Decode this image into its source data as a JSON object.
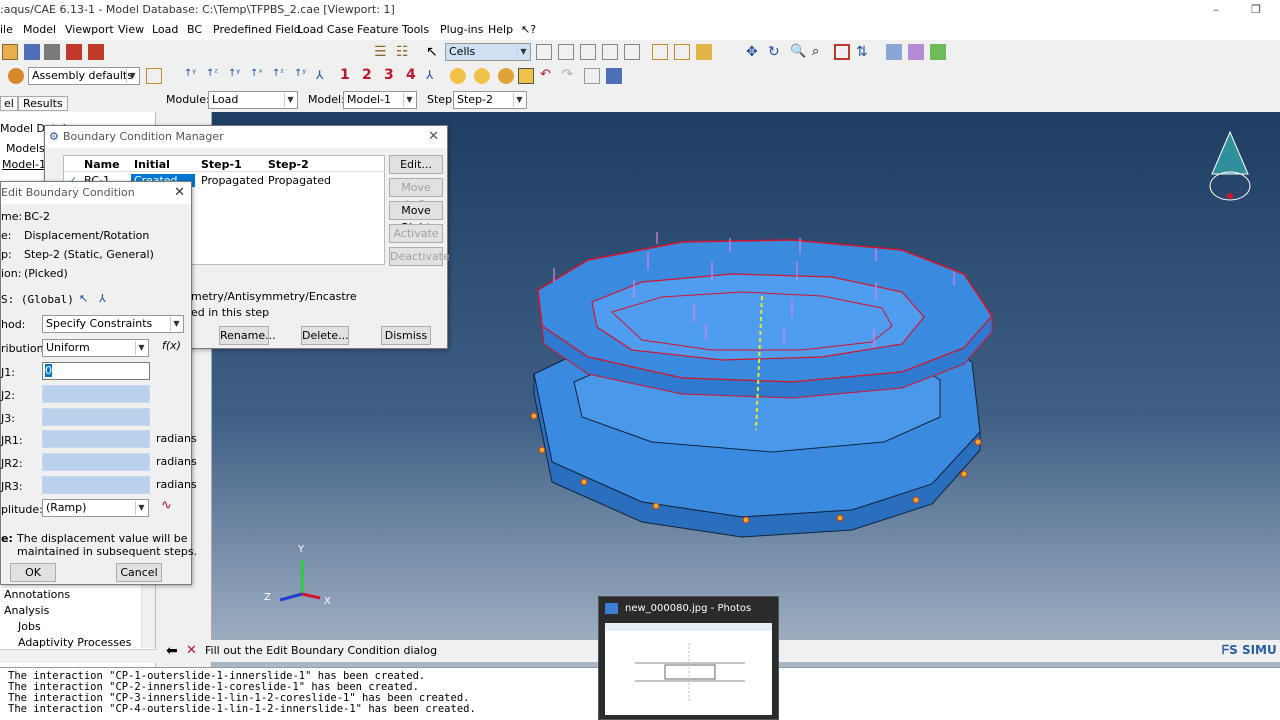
{
  "window": {
    "title": ":aqus/CAE 6.13-1 - Model Database: C:\\Temp\\TFPBS_2.cae [Viewport: 1]"
  },
  "menu": [
    "ile",
    "Model",
    "Viewport",
    "View",
    "Load",
    "BC",
    "Predefined Field",
    "Load Case",
    "Feature",
    "Tools",
    "Plug-ins",
    "Help",
    "⁄?"
  ],
  "toolbar": {
    "selection_filter": "Cells",
    "render_style": "Assembly defaults",
    "csys_numbers": [
      "1",
      "2",
      "3",
      "4"
    ]
  },
  "context": {
    "module_label": "Module:",
    "module_value": "Load",
    "model_label": "Model:",
    "model_value": "Model-1",
    "step_label": "Step:",
    "step_value": "Step-2"
  },
  "tree": {
    "tabs": [
      "el",
      "Results"
    ],
    "header": "Model Datab",
    "models": "Models",
    "model1": "Model-1",
    "items": [
      "Annotations",
      "Analysis",
      "Jobs",
      "Adaptivity Processes"
    ]
  },
  "bc_manager": {
    "title": "Boundary Condition Manager",
    "columns": [
      "Name",
      "Initial",
      "Step-1",
      "Step-2"
    ],
    "rows": [
      {
        "name": "BC-1",
        "initial": "Created",
        "step1": "Propagated",
        "step2": "Propagated"
      }
    ],
    "buttons": {
      "edit": "Edit...",
      "move_left": "Move Left",
      "move_right": "Move Right",
      "activate": "Activate",
      "deactivate": "Deactivate",
      "rename": "Rename...",
      "delete": "Delete...",
      "dismiss": "Dismiss"
    },
    "info_type": "metry/Antisymmetry/Encastre",
    "info_status": "ed in this step"
  },
  "edit_bc": {
    "title": "Edit Boundary Condition",
    "name_label": "me:",
    "name_value": "BC-2",
    "type_label": "e:",
    "type_value": "Displacement/Rotation",
    "step_label": "p:",
    "step_value": "Step-2 (Static, General)",
    "region_label": "ion:",
    "region_value": "(Picked)",
    "csys_label": "S: (Global)",
    "method_label": "hod:",
    "method_value": "Specify Constraints",
    "distribution_label": "ribution:",
    "distribution_value": "Uniform",
    "fx": "f(x)",
    "u1_label": "J1:",
    "u1_value": "0",
    "u2_label": "J2:",
    "u3_label": "J3:",
    "ur1_label": "JR1:",
    "ur2_label": "JR2:",
    "ur3_label": "JR3:",
    "radians": "radians",
    "amplitude_label": "plitude:",
    "amplitude_value": "(Ramp)",
    "note_label": "e:",
    "note_text": "The displacement value will be",
    "note_text2": "maintained in subsequent steps.",
    "ok": "OK",
    "cancel": "Cancel"
  },
  "status": {
    "prompt": "Fill out the Edit Boundary Condition dialog"
  },
  "console": [
    "The interaction \"CP-1-outerslide-1-innerslide-1\" has been created.",
    "The interaction \"CP-2-innerslide-1-coreslide-1\" has been created.",
    "The interaction \"CP-3-innerslide-1-lin-1-2-coreslide-1\" has been created.",
    "The interaction \"CP-4-outerslide-1-lin-1-2-innerslide-1\" has been created."
  ],
  "photos": {
    "title": "new_000080.jpg - Photos"
  },
  "brand": "SIMU",
  "triad": {
    "y": "Y",
    "z": "Z",
    "x": "X"
  },
  "colors": {
    "part": "#3a8be0",
    "mesh_edge": "#d4142a",
    "load_arrow": "#e07de6",
    "bc_marker": "#f5a623"
  }
}
